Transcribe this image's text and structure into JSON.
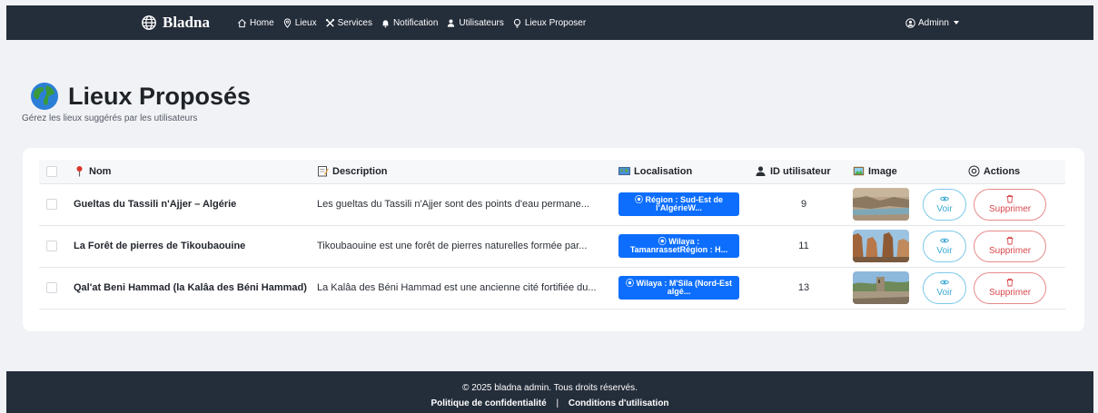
{
  "navbar": {
    "brand": "Bladna",
    "items": [
      {
        "label": "Home",
        "icon": "home-icon"
      },
      {
        "label": "Lieux",
        "icon": "map-pin-icon"
      },
      {
        "label": "Services",
        "icon": "tools-icon"
      },
      {
        "label": "Notification",
        "icon": "bell-icon"
      },
      {
        "label": "Utilisateurs",
        "icon": "user-icon"
      },
      {
        "label": "Lieux Proposer",
        "icon": "lightbulb-icon"
      }
    ],
    "user": "Adminn"
  },
  "page": {
    "title": "Lieux Proposés",
    "subtitle": "Gérez les lieux suggérés par les utilisateurs"
  },
  "table": {
    "headers": {
      "name": "Nom",
      "description": "Description",
      "location": "Localisation",
      "user_id": "ID utilisateur",
      "image": "Image",
      "actions": "Actions"
    },
    "rows": [
      {
        "name": "Gueltas du Tassili n'Ajjer – Algérie",
        "description": "Les gueltas du Tassili n'Ajjer sont des points d'eau permane...",
        "location": "Région : Sud-Est de l'AlgérieW...",
        "user_id": "9",
        "voir": "Voir",
        "supprimer": "Supprimer"
      },
      {
        "name": "La Forêt de pierres de Tikoubaouine",
        "description": "Tikoubaouine est une forêt de pierres naturelles formée par...",
        "location": "Wilaya : TamanrassetRégion : H...",
        "user_id": "11",
        "voir": "Voir",
        "supprimer": "Supprimer"
      },
      {
        "name": "Qal'at Beni Hammad (la Kalâa des Béni Hammad)",
        "description": "La Kalâa des Béni Hammad est une ancienne cité fortifiée du...",
        "location": "Wilaya : M'Sila (Nord-Est algé...",
        "user_id": "13",
        "voir": "Voir",
        "supprimer": "Supprimer"
      }
    ]
  },
  "footer": {
    "copyright": "© 2025 bladna admin. Tous droits réservés.",
    "privacy": "Politique de confidentialité",
    "separator": "|",
    "terms": "Conditions d'utilisation"
  },
  "colors": {
    "navbar_bg": "#242d3a",
    "badge_blue": "#0d6efd",
    "voir_color": "#3aa9d4",
    "delete_color": "#d9484c"
  }
}
